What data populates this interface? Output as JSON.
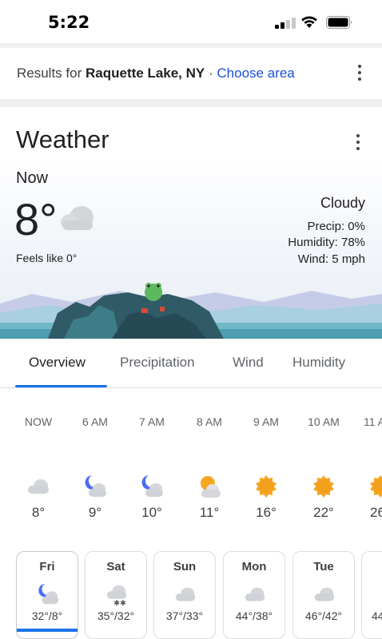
{
  "status_bar": {
    "time": "5:22"
  },
  "results": {
    "prefix": "Results for",
    "location": "Raquette Lake, NY",
    "separator": "·",
    "choose_area": "Choose area"
  },
  "weather": {
    "title": "Weather",
    "now_label": "Now",
    "temperature": "8°",
    "feels_like": "Feels like 0°",
    "condition": "Cloudy",
    "precip": "Precip: 0%",
    "humidity": "Humidity: 78%",
    "wind": "Wind: 5 mph",
    "current_icon": "cloud-icon"
  },
  "tabs": [
    {
      "label": "Overview",
      "active": true
    },
    {
      "label": "Precipitation",
      "active": false
    },
    {
      "label": "Wind",
      "active": false
    },
    {
      "label": "Humidity",
      "active": false
    }
  ],
  "hourly": [
    {
      "time": "NOW",
      "icon": "cloud-icon",
      "temp": "8°"
    },
    {
      "time": "6 AM",
      "icon": "moon-cloud-icon",
      "temp": "9°"
    },
    {
      "time": "7 AM",
      "icon": "moon-cloud-icon",
      "temp": "10°"
    },
    {
      "time": "8 AM",
      "icon": "sun-cloud-icon",
      "temp": "11°"
    },
    {
      "time": "9 AM",
      "icon": "sun-icon",
      "temp": "16°"
    },
    {
      "time": "10 AM",
      "icon": "sun-icon",
      "temp": "22°"
    },
    {
      "time": "11 A",
      "icon": "sun-icon",
      "temp": "26"
    }
  ],
  "daily": [
    {
      "day": "Fri",
      "icon": "moon-cloud-icon",
      "range": "32°/8°",
      "active": true
    },
    {
      "day": "Sat",
      "icon": "snow-cloud-icon",
      "range": "35°/32°",
      "active": false
    },
    {
      "day": "Sun",
      "icon": "cloud-icon",
      "range": "37°/33°",
      "active": false
    },
    {
      "day": "Mon",
      "icon": "cloud-icon",
      "range": "44°/38°",
      "active": false
    },
    {
      "day": "Tue",
      "icon": "cloud-icon",
      "range": "46°/42°",
      "active": false
    },
    {
      "day": "",
      "icon": "cloud-icon",
      "range": "44",
      "active": false
    }
  ],
  "colors": {
    "accent": "#1a73e8",
    "link": "#1a4fd6",
    "sun": "#f5a623",
    "moon": "#4a6cf7",
    "cloud": "#c9ccd1"
  }
}
